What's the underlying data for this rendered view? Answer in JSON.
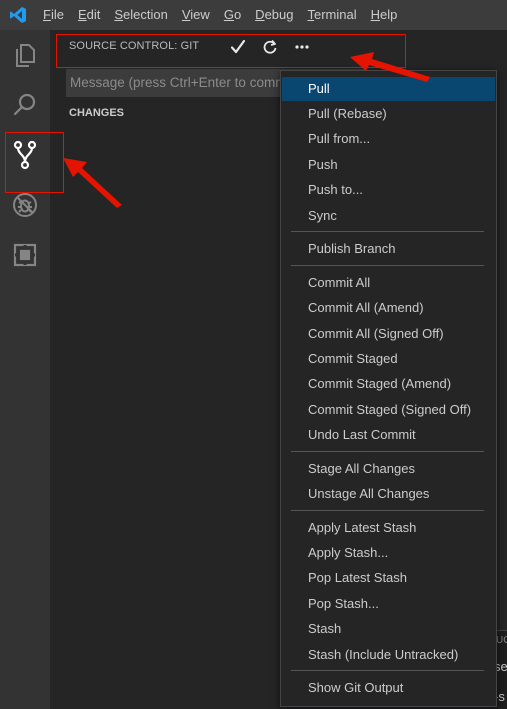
{
  "menubar": {
    "logo_icon": "vscode-logo-icon",
    "items": [
      {
        "mnemonic": "F",
        "rest": "ile"
      },
      {
        "mnemonic": "E",
        "rest": "dit"
      },
      {
        "mnemonic": "S",
        "rest": "election"
      },
      {
        "mnemonic": "V",
        "rest": "iew"
      },
      {
        "mnemonic": "G",
        "rest": "o"
      },
      {
        "mnemonic": "D",
        "rest": "ebug"
      },
      {
        "mnemonic": "T",
        "rest": "erminal"
      },
      {
        "mnemonic": "H",
        "rest": "elp"
      }
    ]
  },
  "activitybar": {
    "items": [
      "explorer-icon",
      "search-icon",
      "source-control-icon",
      "debug-icon",
      "extensions-icon"
    ]
  },
  "sidebar": {
    "title": "SOURCE CONTROL: GIT",
    "message_placeholder": "Message (press Ctrl+Enter to commit)",
    "changes_label": "CHANGES"
  },
  "context_menu": {
    "items": [
      "Pull",
      "Pull (Rebase)",
      "Pull from...",
      "Push",
      "Push to...",
      "Sync",
      "Publish Branch",
      "Commit All",
      "Commit All (Amend)",
      "Commit All (Signed Off)",
      "Commit Staged",
      "Commit Staged (Amend)",
      "Commit Staged (Signed Off)",
      "Undo Last Commit",
      "Stage All Changes",
      "Unstage All Changes",
      "Apply Latest Stash",
      "Apply Stash...",
      "Pop Latest Stash",
      "Pop Stash...",
      "Stash",
      "Stash (Include Untracked)",
      "Show Git Output"
    ]
  },
  "panel_fragments": [
    "UG",
    "se",
    "-s"
  ],
  "colors": {
    "accent": "#094771",
    "highlight_red": "#e51400",
    "menubar_bg": "#3c3c3c",
    "activitybar_bg": "#333333",
    "sidebar_bg": "#252526"
  }
}
